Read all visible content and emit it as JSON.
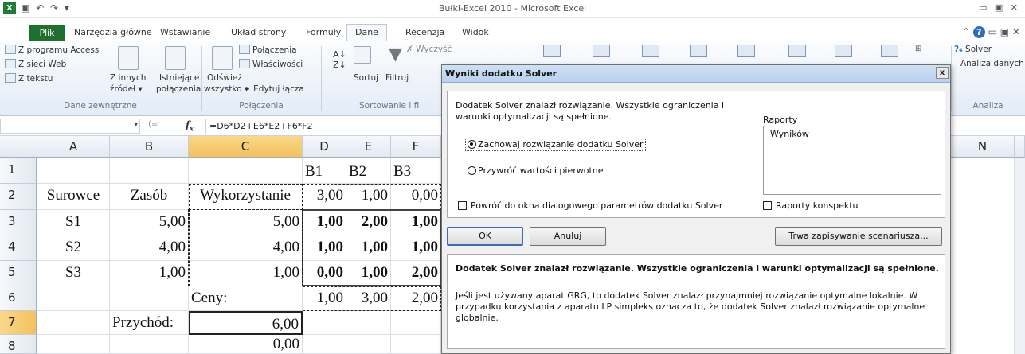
{
  "window": {
    "title": "Bułki-Excel 2010 - Microsoft Excel"
  },
  "ribbon": {
    "tabs": [
      "Plik",
      "Narzędzia główne",
      "Wstawianie",
      "Układ strony",
      "Formuły",
      "Dane",
      "Recenzja",
      "Widok"
    ],
    "active_tab": "Dane",
    "external": {
      "access": "Z programu Access",
      "web": "Z sieci Web",
      "text": "Z tekstu",
      "other_1": "Z innych",
      "other_2": "źródeł",
      "existing_1": "Istniejące",
      "existing_2": "połączenia",
      "group": "Dane zewnętrzne"
    },
    "connections": {
      "refresh_1": "Odśwież",
      "refresh_2": "wszystko",
      "connections": "Połączenia",
      "properties": "Właściwości",
      "edit_links": "Edytuj łącza",
      "group": "Połączenia"
    },
    "sort": {
      "sort": "Sortuj",
      "filter": "Filtruj",
      "clear": "Wyczyść",
      "group": "Sortowanie i fi"
    },
    "analysis": {
      "solver": "Solver",
      "data_analysis": "Analiza danych",
      "group": "Analiza"
    }
  },
  "formula_bar": {
    "formula": "=D6*D2+E6*E2+F6*F2"
  },
  "sheet": {
    "columns": [
      "A",
      "B",
      "C",
      "D",
      "E",
      "F",
      "N"
    ],
    "selected_column": "C",
    "rows": [
      "1",
      "2",
      "3",
      "4",
      "5",
      "6",
      "7",
      "8"
    ],
    "selected_row": "7",
    "cells": {
      "D1": "B1",
      "E1": "B2",
      "F1": "B3",
      "A2": "Surowce",
      "B2": "Zasób",
      "C2": "Wykorzystanie",
      "D2": "3,00",
      "E2": "1,00",
      "F2": "0,00",
      "A3": "S1",
      "B3": "5,00",
      "C3": "5,00",
      "D3": "1,00",
      "E3": "2,00",
      "F3": "1,00",
      "A4": "S2",
      "B4": "4,00",
      "C4": "4,00",
      "D4": "1,00",
      "E4": "1,00",
      "F4": "1,00",
      "A5": "S3",
      "B5": "1,00",
      "C5": "1,00",
      "D5": "0,00",
      "E5": "1,00",
      "F5": "2,00",
      "C6": "Ceny:",
      "D6": "1,00",
      "E6": "3,00",
      "F6": "2,00",
      "B7": "Przychód:",
      "C7": "6,00",
      "C8": "0,00"
    }
  },
  "dialog": {
    "title": "Wyniki dodatku Solver",
    "close": "x",
    "found_1": "Dodatek Solver znalazł rozwiązanie. Wszystkie ograniczenia i",
    "found_2": "warunki optymalizacji są spełnione.",
    "keep_solution": "Zachowaj rozwiązanie dodatku Solver",
    "restore_values": "Przywróć wartości pierwotne",
    "return_dialog": "Powróć do okna dialogowego parametrów dodatku Solver",
    "reports_label": "Raporty",
    "report_item": "Wyników",
    "outline_reports": "Raporty konspektu",
    "ok": "OK",
    "cancel": "Anuluj",
    "save_scenario": "Trwa zapisywanie scenariusza...",
    "msg_bold": "Dodatek Solver znalazł rozwiązanie. Wszystkie ograniczenia i warunki optymalizacji są spełnione.",
    "msg_1": "Jeśli jest używany aparat GRG, to dodatek Solver znalazł przynajmniej rozwiązanie optymalne lokalnie. W",
    "msg_2": "przypadku korzystania z aparatu LP simpleks oznacza to, że dodatek Solver znalazł rozwiązanie optymalne",
    "msg_3": "globalnie."
  }
}
